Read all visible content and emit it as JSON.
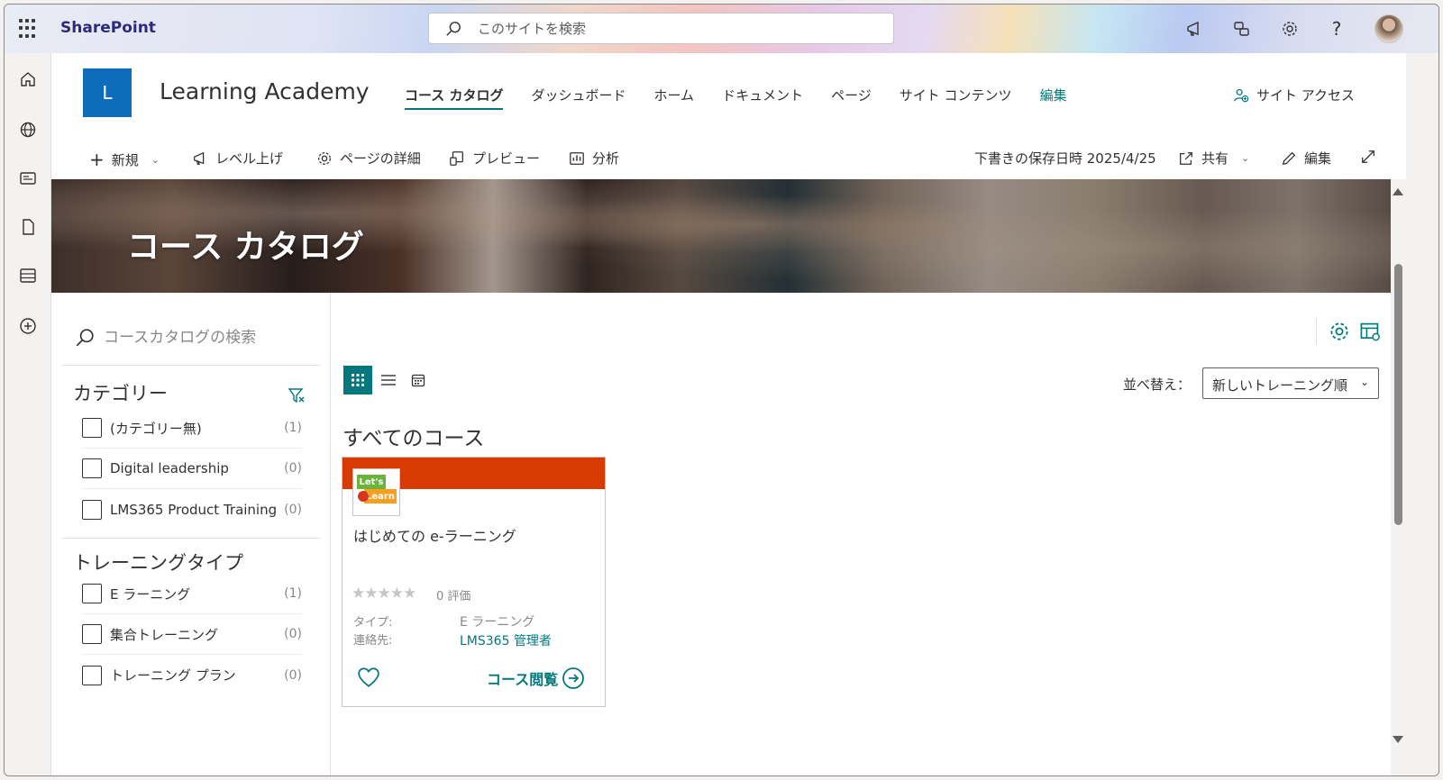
{
  "suite_bar": {
    "app_name": "SharePoint",
    "search_placeholder": "このサイトを検索",
    "icons": [
      "megaphone-icon",
      "feedback-icon",
      "settings-icon",
      "help-icon"
    ],
    "help_glyph": "?"
  },
  "left_rail": {
    "icons": [
      "home-icon",
      "globe-icon",
      "news-icon",
      "document-icon",
      "list-icon",
      "add-icon"
    ]
  },
  "site_header": {
    "logo_letter": "L",
    "logo_color": "#0f6cbd",
    "title": "Learning Academy",
    "nav": [
      {
        "label": "コース カタログ",
        "active": true
      },
      {
        "label": "ダッシュボード"
      },
      {
        "label": "ホーム"
      },
      {
        "label": "ドキュメント"
      },
      {
        "label": "ページ"
      },
      {
        "label": "サイト コンテンツ"
      },
      {
        "label": "編集",
        "accent": true
      }
    ],
    "site_access": "サイト アクセス"
  },
  "command_bar": {
    "new": "新規",
    "promote": "レベル上げ",
    "page_details": "ページの詳細",
    "preview": "プレビュー",
    "analytics": "分析",
    "draft_saved": "下書きの保存日時 2025/4/25",
    "share": "共有",
    "edit": "編集"
  },
  "hero": {
    "title": "コース カタログ"
  },
  "filter_panel": {
    "search_placeholder": "コースカタログの検索",
    "category": {
      "title": "カテゴリー",
      "options": [
        {
          "label": "(カテゴリー無)",
          "count": "(1)"
        },
        {
          "label": "Digital leadership",
          "count": "(0)"
        },
        {
          "label": "LMS365 Product Training",
          "count": "(0)"
        }
      ]
    },
    "training_type": {
      "title": "トレーニングタイプ",
      "options": [
        {
          "label": "E ラーニング",
          "count": "(1)"
        },
        {
          "label": "集合トレーニング",
          "count": "(0)"
        },
        {
          "label": "トレーニング プラン",
          "count": "(0)"
        }
      ]
    }
  },
  "catalog": {
    "sort_label": "並べ替え：",
    "sort_value": "新しいトレーニング順",
    "section_title": "すべてのコース",
    "accent_color": "#03787c",
    "card": {
      "band_color": "#d83b01",
      "thumb_text_1": "Let's",
      "thumb_text_2": "Learn",
      "title": "はじめての e-ラーニング",
      "stars": "★★★★★",
      "rating": 0,
      "rating_text": "0 評価",
      "type_label": "タイプ:",
      "type_value": "E ラーニング",
      "contact_label": "連絡先:",
      "contact_value": "LMS365 管理者",
      "open_label": "コース閲覧"
    }
  }
}
